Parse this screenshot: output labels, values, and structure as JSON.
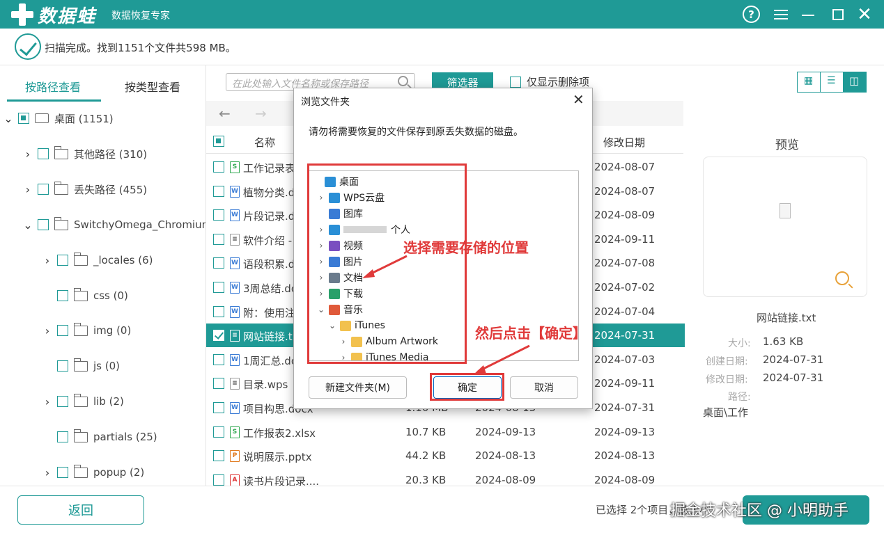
{
  "app": {
    "logo_text": "数据蛙",
    "subtitle": "数据恢复专家"
  },
  "titlebar": {
    "help_glyph": "?",
    "close_glyph": "✕"
  },
  "status": {
    "message": "扫描完成。找到1151个文件共598 MB。"
  },
  "left": {
    "tabs": [
      "按路径查看",
      "按类型查看"
    ],
    "tree": [
      {
        "label": "桌面 (1151)",
        "expanded": true,
        "state": "partial",
        "icon": "drive-icon"
      },
      {
        "label": "其他路径 (310)",
        "expanded": false,
        "state": "none",
        "icon": "folder-icon"
      },
      {
        "label": "丢失路径 (455)",
        "expanded": false,
        "state": "none",
        "icon": "folder-icon"
      },
      {
        "label": "SwitchyOmega_Chromium",
        "expanded": true,
        "state": "none",
        "icon": "folder-icon"
      },
      {
        "label": "_locales (6)",
        "expanded": false,
        "state": "none",
        "icon": "folder-icon"
      },
      {
        "label": "css (0)",
        "expanded": null,
        "state": "none",
        "icon": "folder-icon"
      },
      {
        "label": "img (0)",
        "expanded": false,
        "state": "none",
        "icon": "folder-icon"
      },
      {
        "label": "js (0)",
        "expanded": null,
        "state": "none",
        "icon": "folder-icon"
      },
      {
        "label": "lib (2)",
        "expanded": false,
        "state": "none",
        "icon": "folder-icon"
      },
      {
        "label": "partials (25)",
        "expanded": null,
        "state": "none",
        "icon": "folder-icon"
      },
      {
        "label": "popup (2)",
        "expanded": false,
        "state": "none",
        "icon": "folder-icon"
      }
    ]
  },
  "toolbar": {
    "search_placeholder": "在此处输入文件名称或保存路径",
    "filter_label": "筛选器",
    "deleted_only_label": "仅显示删除项",
    "nav_back": "←",
    "nav_forward": "→"
  },
  "table": {
    "headers": {
      "name": "名称",
      "modified": "修改日期"
    },
    "rows": [
      {
        "icon": "xls",
        "name": "工作记录表",
        "size": "",
        "created": "",
        "modified": "2024-08-07",
        "selected": false
      },
      {
        "icon": "doc",
        "name": "植物分类.d",
        "size": "",
        "created": "",
        "modified": "2024-08-07",
        "selected": false
      },
      {
        "icon": "doc",
        "name": "片段记录.d",
        "size": "",
        "created": "",
        "modified": "2024-08-09",
        "selected": false
      },
      {
        "icon": "txt",
        "name": "软件介绍 -",
        "size": "",
        "created": "",
        "modified": "2024-09-11",
        "selected": false
      },
      {
        "icon": "doc",
        "name": "语段积累.d",
        "size": "",
        "created": "",
        "modified": "2024-07-08",
        "selected": false
      },
      {
        "icon": "doc",
        "name": "3周总结.do",
        "size": "",
        "created": "",
        "modified": "2024-07-02",
        "selected": false
      },
      {
        "icon": "doc",
        "name": "附：使用注",
        "size": "",
        "created": "",
        "modified": "2024-07-04",
        "selected": false
      },
      {
        "icon": "txt",
        "name": "网站链接.t",
        "size": "",
        "created": "",
        "modified": "2024-07-31",
        "selected": true
      },
      {
        "icon": "doc",
        "name": "1周汇总.do",
        "size": "",
        "created": "",
        "modified": "2024-07-03",
        "selected": false
      },
      {
        "icon": "txt",
        "name": "目录.wps",
        "size": "",
        "created": "",
        "modified": "2024-09-11",
        "selected": false
      },
      {
        "icon": "doc",
        "name": "项目构思.docx",
        "size": "1.10 MB",
        "created": "2024-08-13",
        "modified": "2024-07-31",
        "selected": false
      },
      {
        "icon": "xls",
        "name": "工作报表2.xlsx",
        "size": "10.7 KB",
        "created": "2024-09-13",
        "modified": "2024-09-13",
        "selected": false
      },
      {
        "icon": "ppt",
        "name": "说明展示.pptx",
        "size": "44.2 KB",
        "created": "2024-08-13",
        "modified": "2024-08-13",
        "selected": false
      },
      {
        "icon": "pdf",
        "name": "读书片段记录....",
        "size": "20.3 KB",
        "created": "2024-08-09",
        "modified": "2024-08-09",
        "selected": false
      }
    ]
  },
  "preview": {
    "title": "预览",
    "filename": "网站链接.txt",
    "size_label": "大小:",
    "size": "1.63 KB",
    "created_label": "创建日期:",
    "created": "2024-07-31",
    "modified_label": "修改日期:",
    "modified": "2024-07-31",
    "path_label": "路径:",
    "path": "桌面\\工作"
  },
  "bottom": {
    "back_label": "返回",
    "selected_info": "已选择 2个项目，总大小",
    "watermark": "掘金技术社区 @ 小明助手"
  },
  "dialog": {
    "title": "浏览文件夹",
    "message": "请勿将需要恢复的文件保存到原丢失数据的磁盘。",
    "tree": [
      {
        "label": "桌面",
        "chev": "",
        "icon_color": "#2a8fd6"
      },
      {
        "label": "WPS云盘",
        "chev": "›",
        "icon_color": "#2a8fd6"
      },
      {
        "label": "图库",
        "chev": "",
        "icon_color": "#3a7bd5"
      },
      {
        "label": "个人",
        "chev": "›",
        "icon_color": "#2a8fd6"
      },
      {
        "label": "视频",
        "chev": "›",
        "icon_color": "#7a4ec0"
      },
      {
        "label": "图片",
        "chev": "›",
        "icon_color": "#3a7bd5"
      },
      {
        "label": "文档",
        "chev": "›",
        "icon_color": "#6a7b8c"
      },
      {
        "label": "下载",
        "chev": "›",
        "icon_color": "#2aa06a"
      },
      {
        "label": "音乐",
        "chev": "⌄",
        "icon_color": "#e05a3a"
      },
      {
        "label": "iTunes",
        "chev": "⌄",
        "icon_color": "#f2c14e"
      },
      {
        "label": "Album Artwork",
        "chev": "›",
        "icon_color": "#f2c14e"
      },
      {
        "label": "iTunes Media",
        "chev": "›",
        "icon_color": "#f2c14e"
      }
    ],
    "new_folder_label": "新建文件夹(M)",
    "ok_label": "确定",
    "cancel_label": "取消"
  },
  "annotations": {
    "select_location": "选择需要存储的位置",
    "click_ok": "然后点击【确定】",
    "color": "#e03a3a"
  }
}
